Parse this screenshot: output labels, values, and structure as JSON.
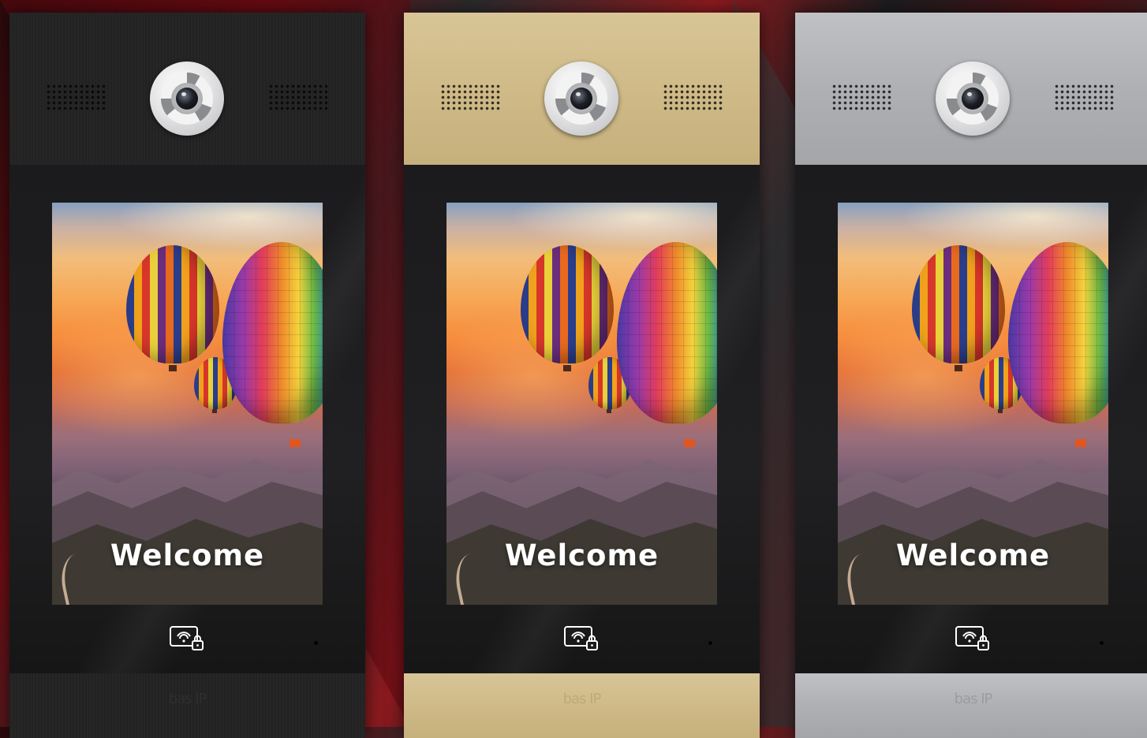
{
  "panels": [
    {
      "id": "panel-black",
      "finish": "black",
      "finish_color": "#232324",
      "welcome_text": "Welcome",
      "logo_text": "bas IP"
    },
    {
      "id": "panel-gold",
      "finish": "gold",
      "finish_color": "#cfba88",
      "welcome_text": "Welcome",
      "logo_text": "bas IP"
    },
    {
      "id": "panel-silver",
      "finish": "silver",
      "finish_color": "#aeb0b3",
      "welcome_text": "Welcome",
      "logo_text": "bas IP"
    }
  ],
  "icons": [
    "camera-icon",
    "speaker-grille-icon",
    "card-reader-lock-icon",
    "indicator-led-icon",
    "brand-logo-icon"
  ],
  "colors": {
    "background_red": "#6b0d12",
    "background_dark": "#1c1c1e",
    "welcome_text": "#ffffff"
  }
}
